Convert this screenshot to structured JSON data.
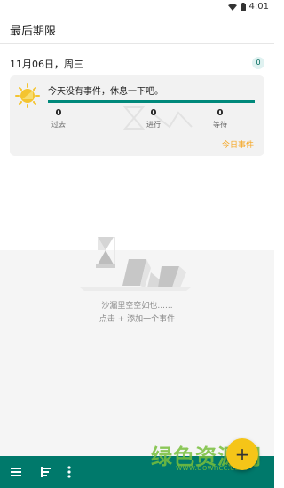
{
  "status": {
    "time": "4:01"
  },
  "appbar": {
    "title": "最后期限"
  },
  "header": {
    "date": "11月06日，周三",
    "count": "0"
  },
  "card": {
    "message": "今天没有事件，休息一下吧。",
    "stats": [
      {
        "value": "0",
        "label": "过去"
      },
      {
        "value": "0",
        "label": "进行"
      },
      {
        "value": "0",
        "label": "等待"
      }
    ],
    "today_link": "今日事件"
  },
  "empty": {
    "line1": "沙漏里空空如也......",
    "line2": "点击 + 添加一个事件"
  },
  "fab": {
    "label": "+"
  },
  "watermark": {
    "text": "绿色资源网",
    "url": "www.downcc.com"
  },
  "colors": {
    "primary": "#00796b",
    "accent": "#f5c518",
    "bar": "#00897b",
    "link": "#f5a623"
  }
}
